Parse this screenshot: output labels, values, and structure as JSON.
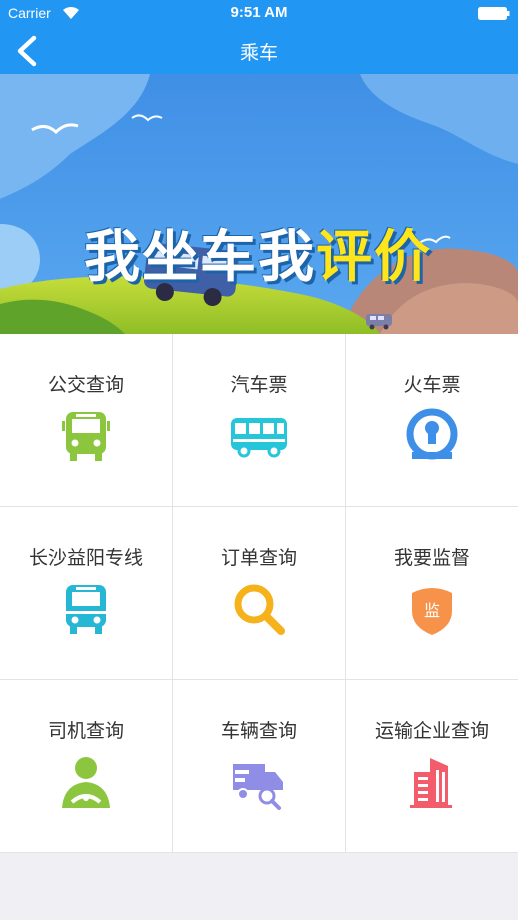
{
  "status_bar": {
    "carrier": "Carrier",
    "time": "9:51 AM"
  },
  "nav": {
    "title": "乘车",
    "back_icon": "chevron-left-icon"
  },
  "banner": {
    "text_main": "我坐车我",
    "text_highlight": "评价"
  },
  "grid": {
    "items": [
      {
        "label": "公交查询",
        "icon": "bus-front-icon",
        "color": "#8cc63f"
      },
      {
        "label": "汽车票",
        "icon": "coach-bus-icon",
        "color": "#26c6da"
      },
      {
        "label": "火车票",
        "icon": "railway-logo-icon",
        "color": "#3d8fe8"
      },
      {
        "label": "长沙益阳专线",
        "icon": "bus-front-icon",
        "color": "#26b7d4"
      },
      {
        "label": "订单查询",
        "icon": "magnifier-icon",
        "color": "#f6b21a"
      },
      {
        "label": "我要监督",
        "icon": "shield-icon",
        "color": "#f7924a",
        "badge": "监"
      },
      {
        "label": "司机查询",
        "icon": "driver-icon",
        "color": "#8cc63f"
      },
      {
        "label": "车辆查询",
        "icon": "truck-search-icon",
        "color": "#8f8de6"
      },
      {
        "label": "运输企业查询",
        "icon": "building-icon",
        "color": "#f25c6b"
      }
    ]
  }
}
